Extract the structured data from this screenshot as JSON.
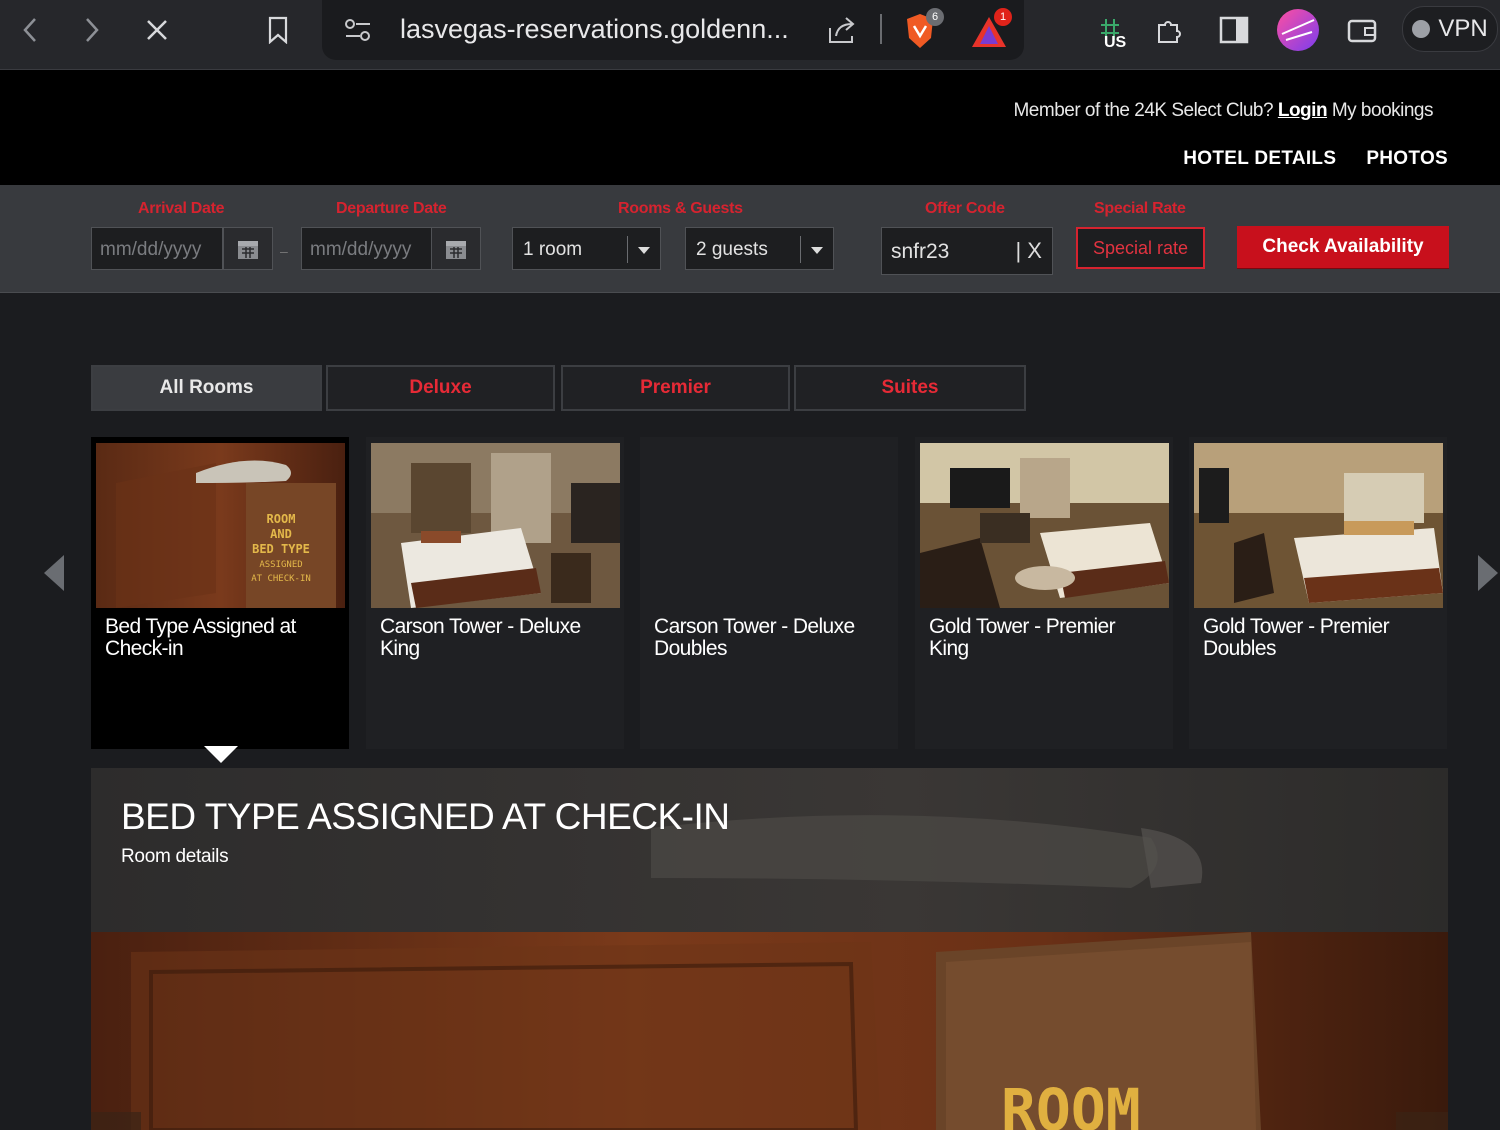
{
  "browser": {
    "url": "lasvegas-reservations.goldenn...",
    "brave_badge": "6",
    "alert_badge": "1",
    "vpn_region": "US",
    "vpn_label": "VPN"
  },
  "header": {
    "member_prompt": "Member of the 24K Select Club?",
    "login_label": "Login",
    "bookings_label": "My bookings",
    "nav": [
      "HOTEL DETAILS",
      "PHOTOS"
    ]
  },
  "booking": {
    "arrival_label": "Arrival Date",
    "arrival_placeholder": "mm/dd/yyyy",
    "departure_label": "Departure Date",
    "departure_placeholder": "mm/dd/yyyy",
    "rooms_guests_label": "Rooms & Guests",
    "rooms_value": "1 room",
    "guests_value": "2 guests",
    "offer_label": "Offer Code",
    "offer_value": "snfr23",
    "offer_clear": "| X",
    "special_label": "Special Rate",
    "special_button": "Special rate",
    "check_button": "Check Availability",
    "accent": "#d6232f"
  },
  "tabs": [
    "All Rooms",
    "Deluxe",
    "Premier",
    "Suites"
  ],
  "rooms": [
    {
      "name": "Bed Type Assigned at Check-in",
      "sign_text": [
        "ROOM",
        "AND",
        "BED TYPE",
        "ASSIGNED",
        "AT CHECK-IN"
      ]
    },
    {
      "name": "Carson Tower - Deluxe King"
    },
    {
      "name": "Carson Tower - Deluxe Doubles"
    },
    {
      "name": "Gold Tower - Premier King"
    },
    {
      "name": "Gold Tower - Premier Doubles"
    }
  ],
  "detail": {
    "title": "BED TYPE ASSIGNED AT CHECK-IN",
    "subtitle": "Room details",
    "sign_word": "ROOM"
  }
}
